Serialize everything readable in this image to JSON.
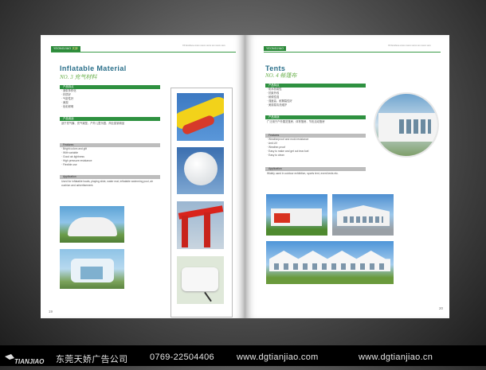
{
  "left_page": {
    "header_logo": "YEONGJ​IAO",
    "header_logo_cn": "天娇",
    "header_info": "XX brochure xxxxx xxxxx\nxxxxx xxx xxxxx xxxx",
    "title": "Inflatable Material",
    "subtitle": "NO. 3 充气材料",
    "section1_label": "产品特点",
    "features_cn": [
      "· 造型多样化",
      "· 材质好",
      "· 气密性好",
      "· 美观",
      "· 色彩鲜明"
    ],
    "section2_label": "产品用途",
    "usage_cn": "适于充气膜、充气城堡、户外儿童乐园、商业促销用品",
    "features_label": "Features",
    "features_en": [
      "· Bright colors and gift",
      "· With variable",
      "· Good air-tightness",
      "· High pressure resistance",
      "· Flexible use"
    ],
    "application_label": "Application",
    "application_text": "Used for inflatable boats, playing slide, water mat, inflatable swimming pool, air cushion and advertisement.",
    "page_number": "19"
  },
  "right_page": {
    "header_logo": "YEONGJIAO",
    "header_info": "XX brochure xxxxx xxxxx\nxxxxx xxx xxxxx xxxx",
    "title": "Tents",
    "subtitle": "NO. 4 帐篷布",
    "section1_label": "产品特点",
    "features_cn": [
      "· 防水防霉性",
      "· 抗紫外线",
      "· 耐候性强",
      "· 强度高，耐撕裂性好",
      "· 美观易清洗维护"
    ],
    "section2_label": "产品用途",
    "usage_cn": "广泛用于户外展览篷房、体育篷房、节庆活动篷房",
    "features_label": "Features",
    "features_en": [
      "· Weatherproof and mold resistance",
      "· Anti-UV",
      "· Weather-proof",
      "· Easy to make and get out tear-fuel",
      "· Easy to clean"
    ],
    "application_label": "Application",
    "application_text": "Widely used in outdoor exhibition, sports tent, event tents etc.",
    "page_number": "20"
  },
  "footer": {
    "company": "东莞天娇广告公司",
    "phone": "0769-22504406",
    "url1": "www.dgtianjiao.com",
    "url2": "www.dgtianjiao.cn",
    "logo_text": "TIANJIAO"
  },
  "colors": {
    "green": "#2e9140",
    "title_blue": "#2a6f8a",
    "subtitle_green": "#6ab04c"
  }
}
